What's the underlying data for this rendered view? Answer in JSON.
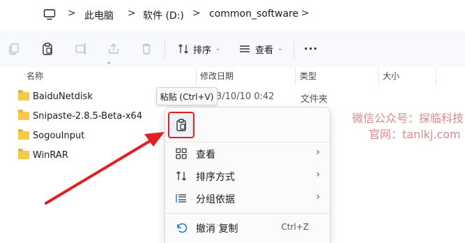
{
  "address_bar": {
    "crumbs": [
      "此电脑",
      "软件 (D:)",
      "common_software"
    ],
    "separator": ">"
  },
  "toolbar": {
    "sort_label": "排序",
    "view_label": "查看",
    "more_label": "···"
  },
  "columns": {
    "name": "名称",
    "modified": "修改日期",
    "type": "类型",
    "size": "大小"
  },
  "files": [
    {
      "name": "BaiduNetdisk",
      "modified": "2023/10/10 0:42",
      "modified_visible": "3/10/10 0:42",
      "type": "文件夹"
    },
    {
      "name": "Snipaste-2.8.5-Beta-x64"
    },
    {
      "name": "SogouInput"
    },
    {
      "name": "WinRAR"
    }
  ],
  "tooltip": {
    "text": "粘贴 (Ctrl+V)"
  },
  "context_menu": {
    "items": [
      {
        "label": "查看",
        "icon": "grid-icon",
        "has_submenu": true
      },
      {
        "label": "排序方式",
        "icon": "sort-icon",
        "has_submenu": true
      },
      {
        "label": "分组依据",
        "icon": "group-icon",
        "has_submenu": true
      },
      {
        "label": "撤消 复制",
        "icon": "undo-icon",
        "shortcut": "Ctrl+Z"
      }
    ]
  },
  "watermark": {
    "line1": "微信公众号：探临科技",
    "line2": "官网：tanlkj.com"
  },
  "colors": {
    "accent_blue": "#1a73d9",
    "folder_yellow": "#f7c948",
    "highlight_red": "#e02020"
  }
}
